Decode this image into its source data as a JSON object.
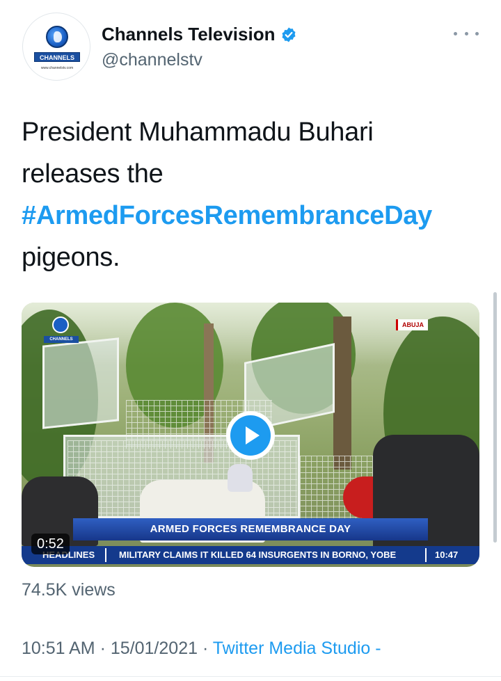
{
  "account": {
    "display_name": "Channels Television",
    "handle": "@channelstv",
    "avatar_brand": "CHANNELS",
    "avatar_url": "www.channelstv.com",
    "verified_icon": "verified-badge-icon",
    "verified_color": "#1d9bf0"
  },
  "tweet": {
    "text_line1": "President Muhammadu Buhari",
    "text_line2": "releases the",
    "hashtag": "#ArmedForcesRemembranceDay",
    "text_line4": "pigeons."
  },
  "video": {
    "channel_logo": "CHANNELS",
    "location_tag": "ABUJA",
    "lower_third": "ARMED FORCES REMEMBRANCE DAY",
    "ticker_label": "HEADLINES",
    "ticker_text": "MILITARY CLAIMS IT KILLED 64 INSURGENTS IN BORNO, YOBE",
    "ticker_time": "10:47",
    "duration": "0:52",
    "play_icon": "play-icon"
  },
  "stats": {
    "views": "74.5K views"
  },
  "meta": {
    "time": "10:51 AM",
    "separator": "·",
    "date": "15/01/2021",
    "source": "Twitter Media Studio -"
  },
  "colors": {
    "link": "#1d9bf0",
    "secondary_text": "#536471",
    "primary_text": "#0f1419"
  }
}
